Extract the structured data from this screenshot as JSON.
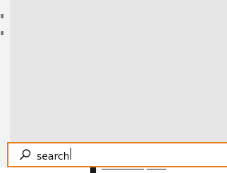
{
  "search": {
    "query": "search",
    "icon": "search-icon",
    "accent_color": "#e67e22"
  }
}
